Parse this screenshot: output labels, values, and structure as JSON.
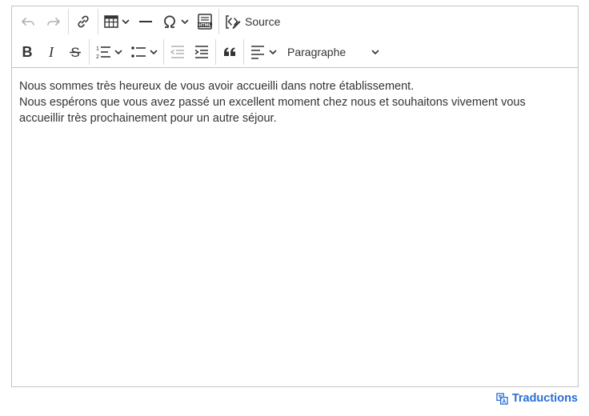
{
  "toolbar": {
    "source_label": "Source",
    "paragraph_select_value": "Paragraphe"
  },
  "content": {
    "line1": "Nous sommes très heureux de vous avoir accueilli dans notre établissement.",
    "line2": "Nous espérons que vous avez passé un excellent moment chez nous et souhaitons vivement vous accueillir très prochainement pour un autre séjour."
  },
  "footer": {
    "translations_label": "Traductions"
  },
  "colors": {
    "link": "#2a6fd6",
    "border": "#c4c4c4",
    "text": "#333333"
  }
}
